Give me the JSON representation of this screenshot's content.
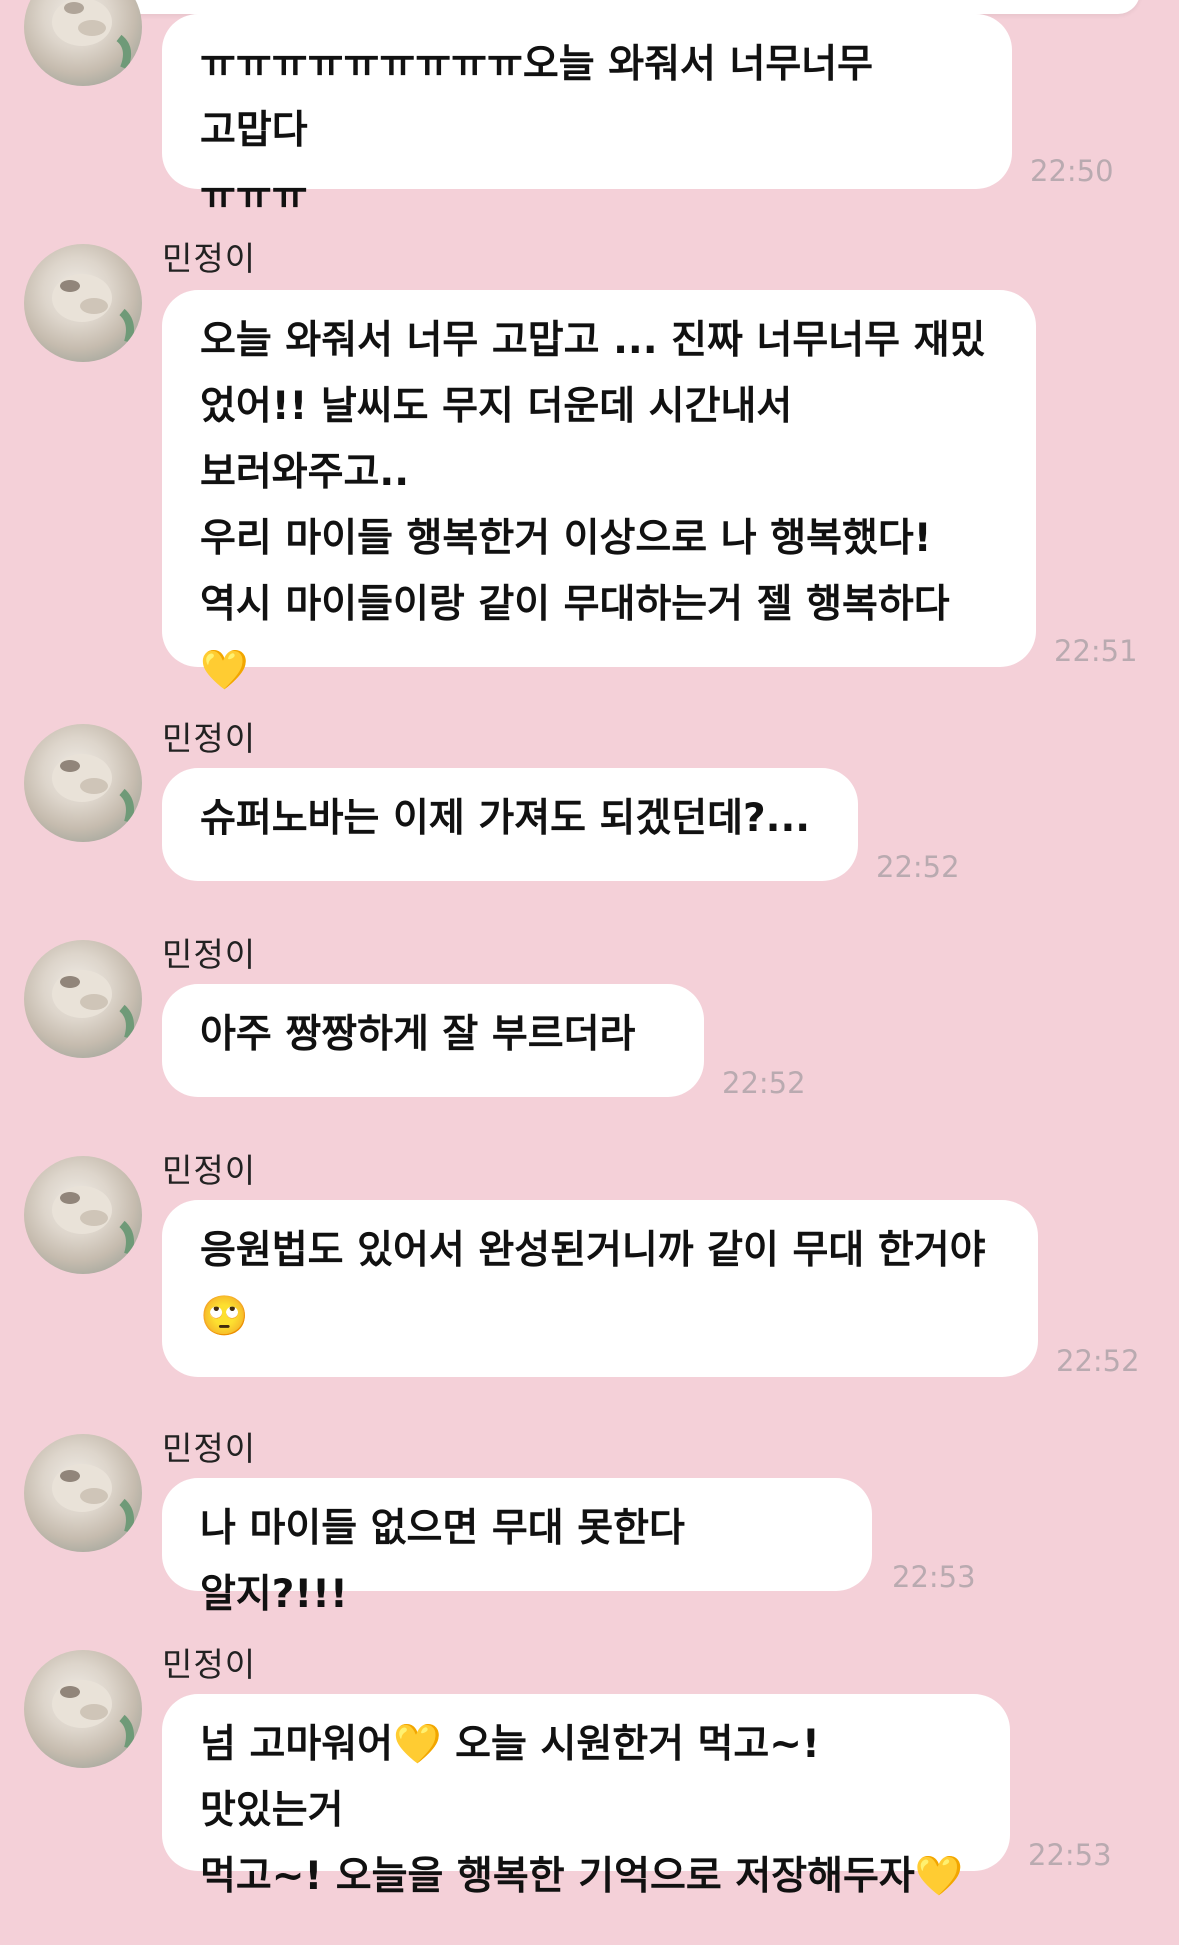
{
  "messages": [
    {
      "sender": "",
      "text": "ㅠㅠㅠㅠㅠㅠㅠㅠㅠ오늘 와줘서 너무너무 고맙다\nㅠㅠㅠ",
      "time": "22:50"
    },
    {
      "sender": "민정이",
      "text": "오늘 와줘서 너무 고맙고 ... 진짜 너무너무 재밌\n었어!! 날씨도 무지 더운데 시간내서 보러와주고..\n우리 마이들 행복한거 이상으로 나 행복했다!\n역시 마이들이랑 같이 무대하는거 젤 행복하다\n💛",
      "time": "22:51"
    },
    {
      "sender": "민정이",
      "text": "슈퍼노바는 이제 가져도 되겠던데?...",
      "time": "22:52"
    },
    {
      "sender": "민정이",
      "text": "아주 짱짱하게 잘 부르더라",
      "time": "22:52"
    },
    {
      "sender": "민정이",
      "text": "응원법도 있어서 완성된거니까 같이 무대 한거야\n🙄",
      "time": "22:52"
    },
    {
      "sender": "민정이",
      "text": "나 마이들 없으면 무대 못한다 알지?!!!",
      "time": "22:53"
    },
    {
      "sender": "민정이",
      "text": "넘 고마워어💛 오늘 시원한거 먹고~! 맛있는거\n먹고~! 오늘을 행복한 기억으로 저장해두자💛",
      "time": "22:53"
    }
  ],
  "colors": {
    "background": "#f4d0d8",
    "bubble": "#ffffff",
    "time": "#b9aab0"
  },
  "icons": {
    "avatar": "profile-avatar-dog"
  }
}
